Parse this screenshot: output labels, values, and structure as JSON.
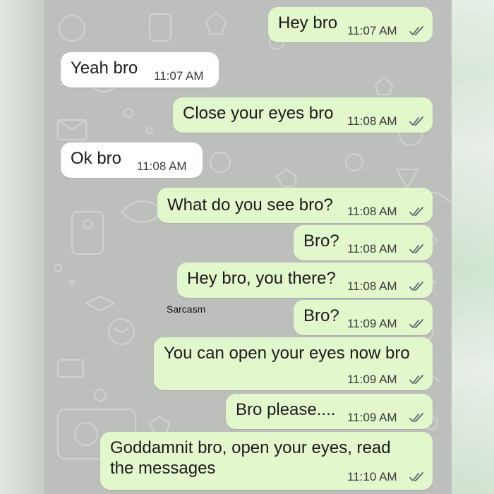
{
  "colors": {
    "outgoing_bubble": "#e2f7cb",
    "incoming_bubble": "#ffffff",
    "read_ticks": "#5b6470",
    "wallpaper": "#bdbfbd"
  },
  "watermark": "Sarcasm",
  "messages": [
    {
      "direction": "outgoing",
      "text": "Hey bro",
      "time": "11:07 AM",
      "status": "double-tick-icon"
    },
    {
      "direction": "incoming",
      "text": "Yeah bro",
      "time": "11:07 AM"
    },
    {
      "direction": "outgoing",
      "text": "Close your eyes bro",
      "time": "11:08 AM",
      "status": "double-tick-icon"
    },
    {
      "direction": "incoming",
      "text": "Ok bro",
      "time": "11:08 AM"
    },
    {
      "direction": "outgoing",
      "text": "What do you see bro?",
      "time": "11:08 AM",
      "status": "double-tick-icon"
    },
    {
      "direction": "outgoing",
      "text": "Bro?",
      "time": "11:08 AM",
      "status": "double-tick-icon"
    },
    {
      "direction": "outgoing",
      "text": "Hey bro, you there?",
      "time": "11:08 AM",
      "status": "double-tick-icon"
    },
    {
      "direction": "outgoing",
      "text": "Bro?",
      "time": "11:09 AM",
      "status": "double-tick-icon"
    },
    {
      "direction": "outgoing",
      "text": "You can open your eyes now bro",
      "time": "11:09 AM",
      "status": "double-tick-icon"
    },
    {
      "direction": "outgoing",
      "text": "Bro please....",
      "time": "11:09 AM",
      "status": "double-tick-icon"
    },
    {
      "direction": "outgoing",
      "text_line1": "Goddamnit bro, open your eyes, read",
      "text_line2": "the messages",
      "time": "11:10 AM",
      "status": "double-tick-icon"
    }
  ]
}
